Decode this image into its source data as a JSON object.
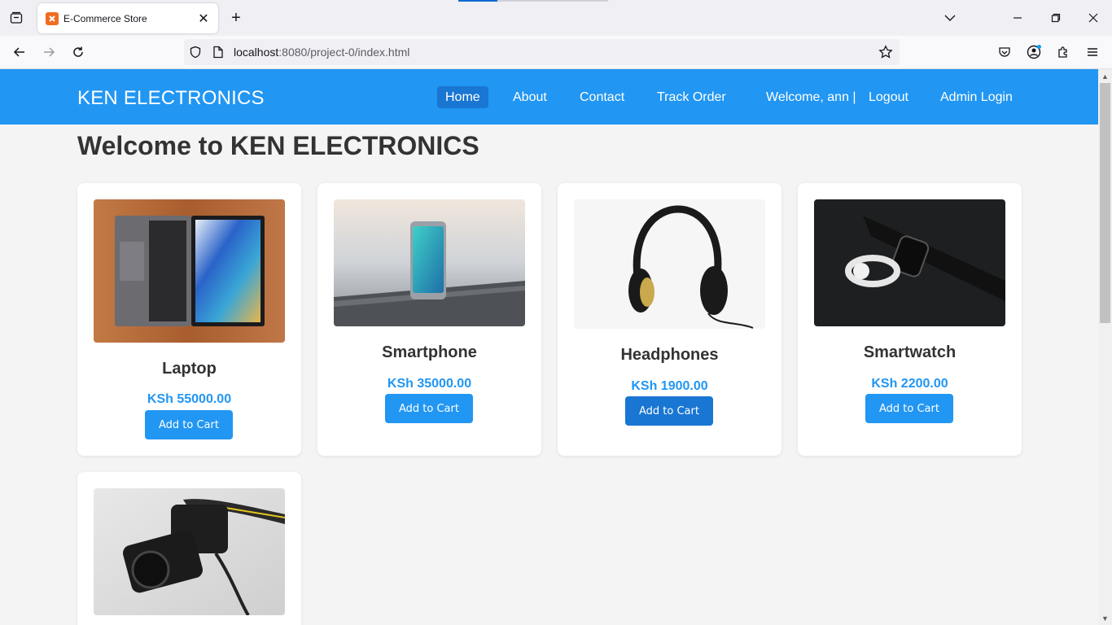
{
  "browser": {
    "tab_title": "E-Commerce Store",
    "url_host": "localhost",
    "url_rest": ":8080/project-0/index.html"
  },
  "site": {
    "brand": "KEN ELECTRONICS",
    "nav": {
      "home": "Home",
      "about": "About",
      "contact": "Contact",
      "track": "Track Order",
      "welcome": "Welcome, ann |",
      "logout": "Logout",
      "admin": "Admin Login"
    },
    "heading": "Welcome to KEN ELECTRONICS",
    "add_to_cart": "Add to Cart",
    "products": [
      {
        "name": "Laptop",
        "price": "KSh 55000.00",
        "icon": "laptop-image"
      },
      {
        "name": "Smartphone",
        "price": "KSh 35000.00",
        "icon": "smartphone-image"
      },
      {
        "name": "Headphones",
        "price": "KSh 1900.00",
        "icon": "headphones-image"
      },
      {
        "name": "Smartwatch",
        "price": "KSh 2200.00",
        "icon": "smartwatch-image"
      },
      {
        "name": "",
        "price": "",
        "icon": "camera-image"
      }
    ]
  },
  "colors": {
    "header": "#2196f3",
    "active_nav": "#1976d2",
    "price": "#2196f3"
  }
}
